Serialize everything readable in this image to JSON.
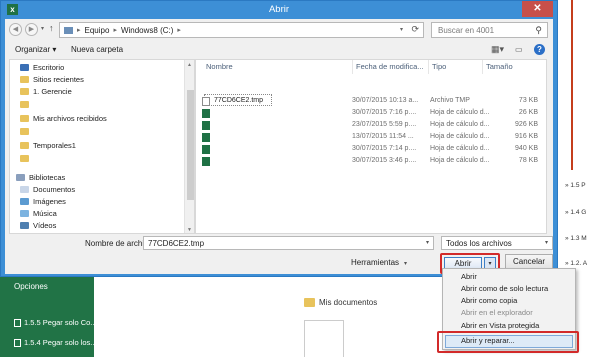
{
  "dialog": {
    "title": "Abrir",
    "close_glyph": "✕",
    "app_icon_letter": "x"
  },
  "nav": {
    "breadcrumbs": [
      "Equipo",
      "Windows8 (C:)"
    ],
    "search_placeholder": "Buscar en 4001"
  },
  "toolbar": {
    "organize_label": "Organizar ▾",
    "new_folder_label": "Nueva carpeta"
  },
  "sidebar": {
    "items": [
      {
        "label": "Escritorio",
        "icon": "desktop-icon"
      },
      {
        "label": "Sitios recientes",
        "icon": "recent-icon"
      },
      {
        "label": "1. Gerencie",
        "icon": "folder-icon"
      },
      {
        "label": "",
        "icon": "folder-icon"
      },
      {
        "label": "Mis archivos recibidos",
        "icon": "folder-icon"
      },
      {
        "label": "",
        "icon": "folder-icon"
      },
      {
        "label": "Temporales1",
        "icon": "folder-icon"
      },
      {
        "label": "",
        "icon": "folder-icon"
      },
      {
        "label": "Bibliotecas",
        "icon": "library-icon"
      },
      {
        "label": "Documentos",
        "icon": "documents-icon"
      },
      {
        "label": "Imágenes",
        "icon": "pictures-icon"
      },
      {
        "label": "Música",
        "icon": "music-icon"
      },
      {
        "label": "Vídeos",
        "icon": "videos-icon"
      }
    ]
  },
  "files": {
    "headers": {
      "name": "Nombre",
      "date": "Fecha de modifica...",
      "type": "Tipo",
      "size": "Tamaño"
    },
    "rows": [
      {
        "name": "77CD6CE2.tmp",
        "date": "30/07/2015 10:13 a...",
        "type": "Archivo TMP",
        "size": "73 KB",
        "icon": "tmp-file-icon"
      },
      {
        "name": "",
        "date": "30/07/2015 7:16 p....",
        "type": "Hoja de cálculo d...",
        "size": "26 KB",
        "icon": "excel-file-icon"
      },
      {
        "name": "",
        "date": "23/07/2015 5:59 p....",
        "type": "Hoja de cálculo d...",
        "size": "926 KB",
        "icon": "excel-file-icon"
      },
      {
        "name": "",
        "date": "13/07/2015 11:54 ...",
        "type": "Hoja de cálculo d...",
        "size": "916 KB",
        "icon": "excel-file-icon"
      },
      {
        "name": "",
        "date": "30/07/2015 7:14 p....",
        "type": "Hoja de cálculo d...",
        "size": "940 KB",
        "icon": "excel-file-icon"
      },
      {
        "name": "",
        "date": "30/07/2015 3:46 p....",
        "type": "Hoja de cálculo d...",
        "size": "78 KB",
        "icon": "excel-file-icon"
      }
    ]
  },
  "bottom": {
    "filename_label": "Nombre de archivo:",
    "filename_value": "77CD6CE2.tmp",
    "filetype_value": "Todos los archivos",
    "tools_label": "Herramientas",
    "open_label": "Abrir",
    "cancel_label": "Cancelar"
  },
  "open_menu": {
    "items": [
      {
        "label": "Abrir",
        "enabled": true
      },
      {
        "label": "Abrir como de solo lectura",
        "enabled": true
      },
      {
        "label": "Abrir como copia",
        "enabled": true
      },
      {
        "label": "Abrir en el explorador",
        "enabled": false
      },
      {
        "label": "Abrir en Vista protegida",
        "enabled": true
      },
      {
        "label": "Abrir y reparar...",
        "enabled": true
      }
    ]
  },
  "background": {
    "options_label": "Opciones",
    "items": [
      "1.5.5 Pegar solo Co...",
      "1.5.4 Pegar solo los..."
    ],
    "mis_documentos": "Mis documentos",
    "right_snippets": [
      "» 1.5 P",
      "» 1.4 G",
      "» 1.3 M",
      "» 1.2. A"
    ]
  }
}
